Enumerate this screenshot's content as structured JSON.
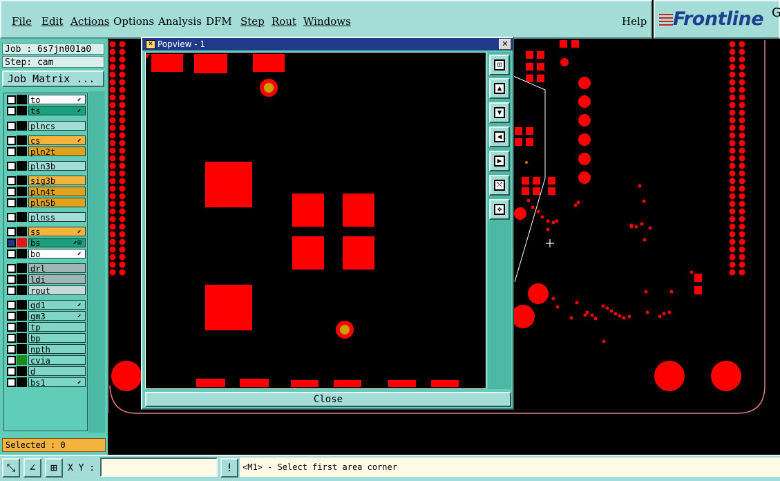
{
  "menu": {
    "items": [
      "File",
      "Edit",
      "Actions",
      "Options",
      "Analysis",
      "DFM",
      "Step",
      "Rout",
      "Windows"
    ],
    "help": "Help"
  },
  "logo": {
    "brand": "Frontline",
    "edge": "G"
  },
  "job": {
    "job_line": "Job : 6s7jn001a0",
    "step_line": "Step: cam",
    "matrix_button": "Job Matrix ..."
  },
  "layers": [
    {
      "name": "to",
      "color": "#ffffff",
      "swatch": "#000000",
      "arrow": "⬋"
    },
    {
      "name": "ts",
      "color": "#1aa07a",
      "swatch": "#000000",
      "arrow": "⬋"
    },
    {
      "name": "plncs",
      "color": "#a4dcd8",
      "swatch": "#000000",
      "arrow": ""
    },
    {
      "name": "cs",
      "color": "#f3b33c",
      "swatch": "#000000",
      "arrow": "⬋"
    },
    {
      "name": "pln2t",
      "color": "#e0a21c",
      "swatch": "#000000",
      "arrow": ""
    },
    {
      "name": "pln3b",
      "color": "#a4dcd8",
      "swatch": "#000000",
      "arrow": ""
    },
    {
      "name": "sig3b",
      "color": "#f3b33c",
      "swatch": "#000000",
      "arrow": ""
    },
    {
      "name": "pln4t",
      "color": "#e0a21c",
      "swatch": "#000000",
      "arrow": ""
    },
    {
      "name": "pln5b",
      "color": "#e0a21c",
      "swatch": "#000000",
      "arrow": ""
    },
    {
      "name": "plnss",
      "color": "#a4dcd8",
      "swatch": "#000000",
      "arrow": ""
    },
    {
      "name": "ss",
      "color": "#f3b33c",
      "swatch": "#000000",
      "arrow": "⬋"
    },
    {
      "name": "bs",
      "color": "#1aa07a",
      "swatch": "#e01818",
      "arrow": "⬋⊞"
    },
    {
      "name": "bo",
      "color": "#ffffff",
      "swatch": "#000000",
      "arrow": "⬋"
    },
    {
      "name": "drl",
      "color": "#9fb6b4",
      "swatch": "#000000",
      "arrow": ""
    },
    {
      "name": "ldi",
      "color": "#9fb6b4",
      "swatch": "#000000",
      "arrow": ""
    },
    {
      "name": "rout",
      "color": "#c8d8d6",
      "swatch": "#000000",
      "arrow": ""
    },
    {
      "name": "gd1",
      "color": "#7fd6c6",
      "swatch": "#000000",
      "arrow": "⬋"
    },
    {
      "name": "gm3",
      "color": "#7fd6c6",
      "swatch": "#000000",
      "arrow": "⬋"
    },
    {
      "name": "tp",
      "color": "#7fd6c6",
      "swatch": "#000000",
      "arrow": ""
    },
    {
      "name": "bp",
      "color": "#7fd6c6",
      "swatch": "#000000",
      "arrow": ""
    },
    {
      "name": "npth",
      "color": "#7fd6c6",
      "swatch": "#000000",
      "arrow": ""
    },
    {
      "name": "cvia",
      "color": "#7fd6c6",
      "swatch": "#1c8a1c",
      "arrow": ""
    },
    {
      "name": "d",
      "color": "#7fd6c6",
      "swatch": "#000000",
      "arrow": ""
    },
    {
      "name": "bs1",
      "color": "#7fd6c6",
      "swatch": "#000000",
      "arrow": "⬋"
    }
  ],
  "status": {
    "selected": "Selected : 0"
  },
  "bottom": {
    "xy_label": "X Y :",
    "xy_value": "",
    "bang": "!",
    "message": "<M1> - Select first area corner"
  },
  "popview": {
    "title": "Popview - 1",
    "close_x": "✕",
    "close_button": "Close"
  },
  "colors": {
    "pad": "#ff0000",
    "via_center": "#c8a000",
    "panel": "#5fcdb8",
    "menubar": "#a4dcd8"
  }
}
